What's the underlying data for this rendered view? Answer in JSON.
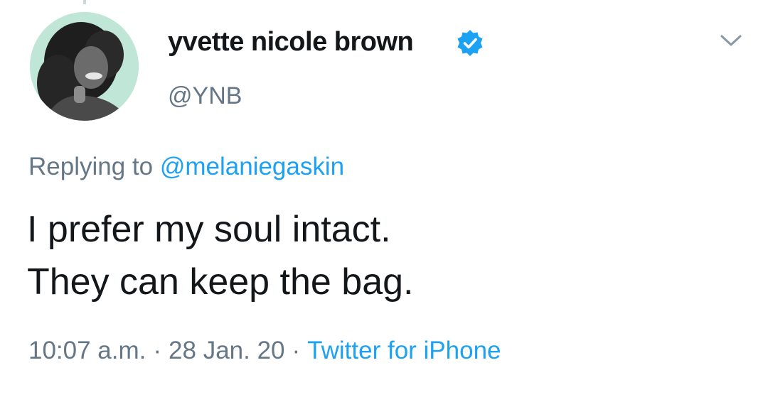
{
  "author": {
    "display_name": "yvette nicole brown",
    "handle": "@YNB",
    "verified": true,
    "avatar_icon": "profile-photo-avatar"
  },
  "reply": {
    "prefix": "Replying to ",
    "mention": "@melaniegaskin"
  },
  "tweet": {
    "lines": [
      "I prefer my soul intact.",
      "They can keep the bag."
    ]
  },
  "meta": {
    "time": "10:07 a.m.",
    "separator": "·",
    "date": "28 Jan. 20",
    "source": "Twitter for iPhone"
  },
  "icons": {
    "verified": "verified-badge-icon",
    "menu": "chevron-down-icon"
  },
  "colors": {
    "text": "#14171a",
    "secondary": "#657786",
    "link": "#1da1f2",
    "avatar_bg": "#bfe6d6"
  }
}
